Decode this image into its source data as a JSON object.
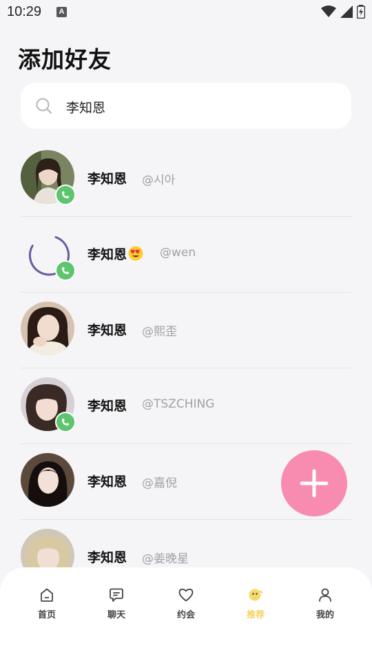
{
  "status_bar": {
    "time": "10:29",
    "notification_icon": "A"
  },
  "page_title": "添加好友",
  "search": {
    "value": "李知恩"
  },
  "results": [
    {
      "name": "李知恩",
      "handle": "@시아",
      "has_call_badge": true
    },
    {
      "name": "李知恩",
      "handle": "@wen",
      "has_call_badge": true,
      "emoji": "heart-eyes-emoji",
      "avatar_loading": true
    },
    {
      "name": "李知恩",
      "handle": "@熙歪",
      "has_call_badge": false
    },
    {
      "name": "李知恩",
      "handle": "@TSZCHING",
      "has_call_badge": true
    },
    {
      "name": "李知恩",
      "handle": "@嘉倪",
      "has_call_badge": false
    },
    {
      "name": "李知恩",
      "handle": "@姜晚星",
      "has_call_badge": false
    }
  ],
  "bottom_nav": [
    {
      "label": "首页",
      "icon": "home-icon"
    },
    {
      "label": "聊天",
      "icon": "chat-icon"
    },
    {
      "label": "约会",
      "icon": "heart-icon"
    },
    {
      "label": "推荐",
      "icon": "recommend-icon",
      "active": true
    },
    {
      "label": "我的",
      "icon": "profile-icon"
    }
  ],
  "colors": {
    "accent_pink": "#f78bb0",
    "call_green": "#5ec46e",
    "active_yellow": "#f4d35e",
    "background": "#f5f5f8"
  }
}
